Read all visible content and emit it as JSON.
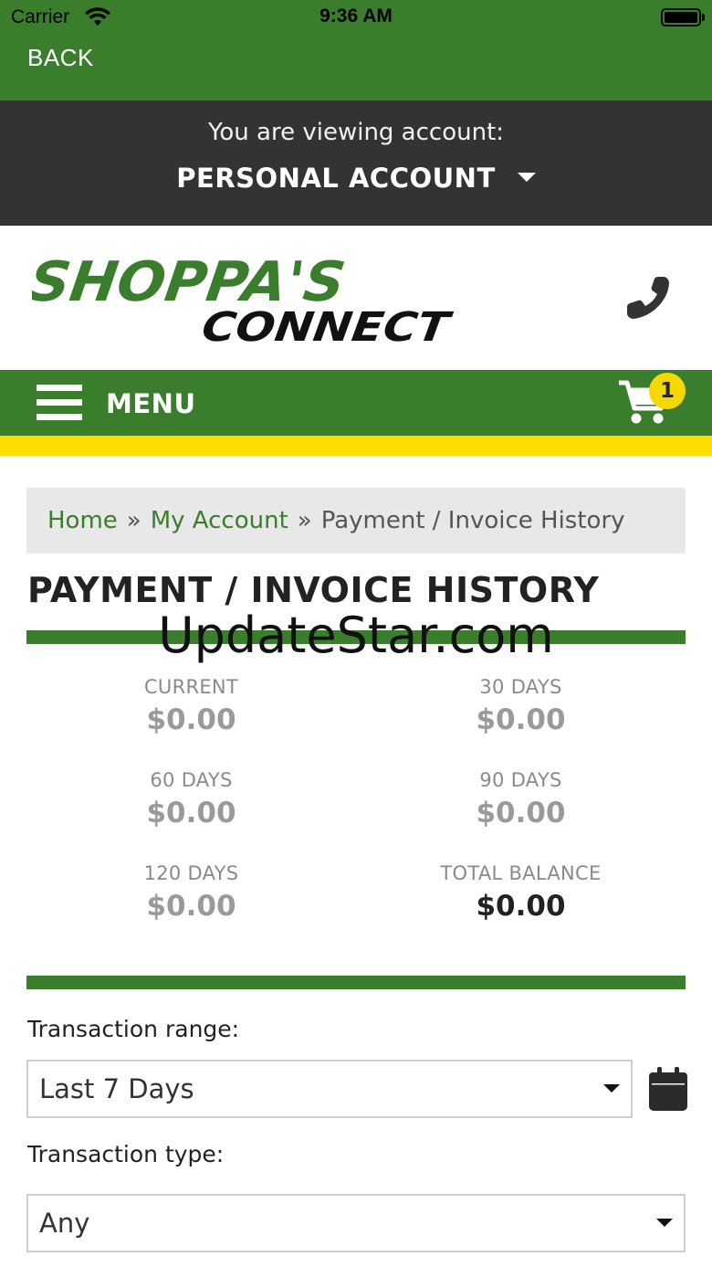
{
  "status": {
    "carrier": "Carrier",
    "time": "9:36 AM"
  },
  "nav": {
    "back_label": "BACK"
  },
  "account": {
    "viewing_label": "You are viewing account:",
    "selected": "PERSONAL ACCOUNT"
  },
  "brand": {
    "logo_line1": "SHOPPA'S",
    "logo_line2": "CONNECT",
    "green": "#3a7e2d",
    "yellow": "#ffdd00"
  },
  "menu": {
    "label": "MENU",
    "cart_count": "1"
  },
  "breadcrumb": {
    "home": "Home",
    "separator": "»",
    "account": "My Account",
    "current": "Payment / Invoice History"
  },
  "page": {
    "title": "PAYMENT / INVOICE HISTORY",
    "watermark": "UpdateStar.com"
  },
  "aging": {
    "current": {
      "label": "CURRENT",
      "amount": "$0.00"
    },
    "days30": {
      "label": "30 DAYS",
      "amount": "$0.00"
    },
    "days60": {
      "label": "60 DAYS",
      "amount": "$0.00"
    },
    "days90": {
      "label": "90 DAYS",
      "amount": "$0.00"
    },
    "days120": {
      "label": "120 DAYS",
      "amount": "$0.00"
    },
    "total": {
      "label": "TOTAL BALANCE",
      "amount": "$0.00"
    }
  },
  "filters": {
    "range_label": "Transaction range:",
    "range_value": "Last 7 Days",
    "type_label": "Transaction type:",
    "type_value": "Any"
  },
  "icons": [
    "wifi-icon",
    "battery-icon",
    "chevron-down-icon",
    "phone-icon",
    "hamburger-icon",
    "cart-icon",
    "calendar-icon"
  ]
}
